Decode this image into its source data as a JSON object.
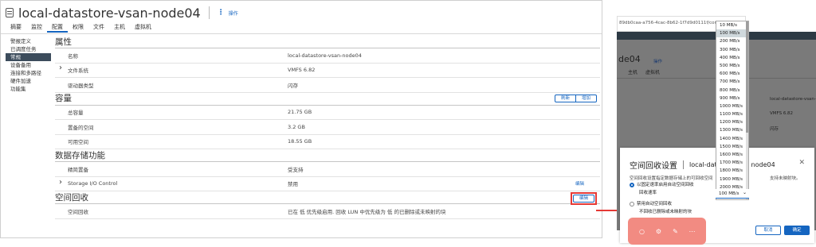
{
  "header": {
    "title": "local-datastore-vsan-node04",
    "actions_label": "操作"
  },
  "tabs": [
    "摘要",
    "监控",
    "配置",
    "权限",
    "文件",
    "主机",
    "虚拟机"
  ],
  "active_tab_index": 2,
  "sidenav": [
    "警报定义",
    "已调度任务",
    "常规",
    "设备备用",
    "连接和多路径",
    "硬件加速",
    "功能集"
  ],
  "active_sidenav_index": 2,
  "sections": {
    "properties": {
      "title": "属性",
      "rows": [
        {
          "key": "名称",
          "value": "local-datastore-vsan-node04"
        },
        {
          "key": "文件系统",
          "value": "VMFS 6.82"
        },
        {
          "key": "驱动器类型",
          "value": "闪存"
        }
      ]
    },
    "capacity": {
      "title": "容量",
      "refresh": "刷新",
      "increase": "增加",
      "rows": [
        {
          "key": "总容量",
          "value": "21.75 GB"
        },
        {
          "key": "置备的空间",
          "value": "3.2 GB"
        },
        {
          "key": "可用空间",
          "value": "18.55 GB"
        }
      ]
    },
    "storage": {
      "title": "数据存储功能",
      "edit": "编辑",
      "rows": [
        {
          "key": "精简置备",
          "value": "受支持"
        },
        {
          "key": "Storage I/O Control",
          "value": "禁用"
        }
      ]
    },
    "reclaim": {
      "title": "空间回收",
      "edit": "编辑",
      "rows": [
        {
          "key": "空间回收",
          "value": "已在 低 优先级启用. 回收 LUN 中优先级为 低 的已删除或未映射的块"
        }
      ]
    }
  },
  "colors": {
    "accent": "#1565c0",
    "highlight": "#e53935",
    "toolbar": "#f28b82"
  },
  "right": {
    "url": "89db0caa-a756-4cac-8b62-1f7d9d0111f/con",
    "bg_title": "de04",
    "bg_actions": "操作",
    "bg_tabs": [
      "主机",
      "虚拟机"
    ],
    "bg_values": [
      "local-datastore-vsan-",
      "VMFS 6.82",
      "闪存"
    ],
    "modal": {
      "title": "空间回收设置",
      "subtitle": "local-data",
      "subtitle_tail": "node04",
      "description": "空间回收设置指定数据存储上的可回收空间",
      "description_tail": "支持未映射块。",
      "option1": "以固定速率启用自动空间回收",
      "rate_label": "回收速率",
      "option2": "禁用自动空间回收",
      "option2_note": "不回收已删除或未映射的块",
      "cancel": "取消",
      "ok": "确定"
    },
    "dropdown": {
      "options": [
        "10 MB/s",
        "100 MB/s",
        "200 MB/s",
        "300 MB/s",
        "400 MB/s",
        "500 MB/s",
        "600 MB/s",
        "700 MB/s",
        "800 MB/s",
        "900 MB/s",
        "1000 MB/s",
        "1100 MB/s",
        "1200 MB/s",
        "1300 MB/s",
        "1400 MB/s",
        "1500 MB/s",
        "1600 MB/s",
        "1700 MB/s",
        "1800 MB/s",
        "1900 MB/s",
        "2000 MB/s"
      ],
      "selected_index": 1,
      "value": "100 MB/s"
    },
    "toolbar_icons": [
      "search-icon",
      "settings-icon",
      "brush-icon",
      "more-icon"
    ]
  }
}
